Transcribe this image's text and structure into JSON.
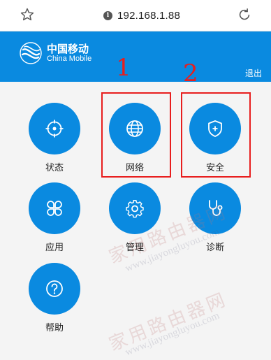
{
  "browser": {
    "url": "192.168.1.88"
  },
  "header": {
    "brand_cn": "中国移动",
    "brand_en": "China Mobile",
    "logout_label": "退出"
  },
  "tiles": [
    {
      "label": "状态",
      "icon": "target-icon"
    },
    {
      "label": "网络",
      "icon": "globe-icon"
    },
    {
      "label": "安全",
      "icon": "shield-plus-icon"
    },
    {
      "label": "应用",
      "icon": "apps-icon"
    },
    {
      "label": "管理",
      "icon": "gear-icon"
    },
    {
      "label": "诊断",
      "icon": "stethoscope-icon"
    },
    {
      "label": "帮助",
      "icon": "help-icon"
    }
  ],
  "annotations": {
    "mark_1": "1",
    "mark_2": "2"
  },
  "watermark": {
    "cn": "家用路由器网",
    "url_text": "www.jiayongluyou.com"
  },
  "colors": {
    "accent": "#0a8ae0",
    "highlight": "#e81e1e"
  }
}
